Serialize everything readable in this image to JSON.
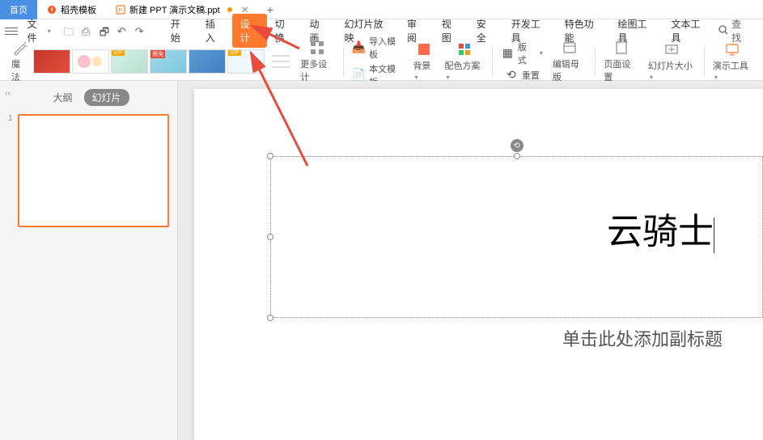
{
  "tabs": {
    "home": "首页",
    "docker": "稻壳模板",
    "file": "新建 PPT 演示文稿.ppt"
  },
  "menu": {
    "file": "文件",
    "find": "查找"
  },
  "ribbon_tabs": {
    "start": "开始",
    "insert": "插入",
    "design": "设计",
    "transition": "切换",
    "animation": "动画",
    "slideshow": "幻灯片放映",
    "review": "审阅",
    "view": "视图",
    "security": "安全",
    "devtools": "开发工具",
    "special": "特色功能",
    "draw": "绘图工具",
    "text": "文本工具"
  },
  "ribbon": {
    "magic": "魔法",
    "more_design": "更多设计",
    "import_template": "导入模板",
    "this_template": "本文模板",
    "background": "背景",
    "color_scheme": "配色方案",
    "layout": "版式",
    "reset": "重置",
    "edit_master": "编辑母版",
    "page_setup": "页面设置",
    "slide_size": "幻灯片大小",
    "present_tools": "演示工具",
    "vip": "VIP",
    "limited": "限免"
  },
  "side": {
    "outline": "大纲",
    "slides": "幻灯片",
    "collapse": "‹‹",
    "num1": "1"
  },
  "slide": {
    "title": "云骑士",
    "subtitle": "单击此处添加副标题"
  }
}
